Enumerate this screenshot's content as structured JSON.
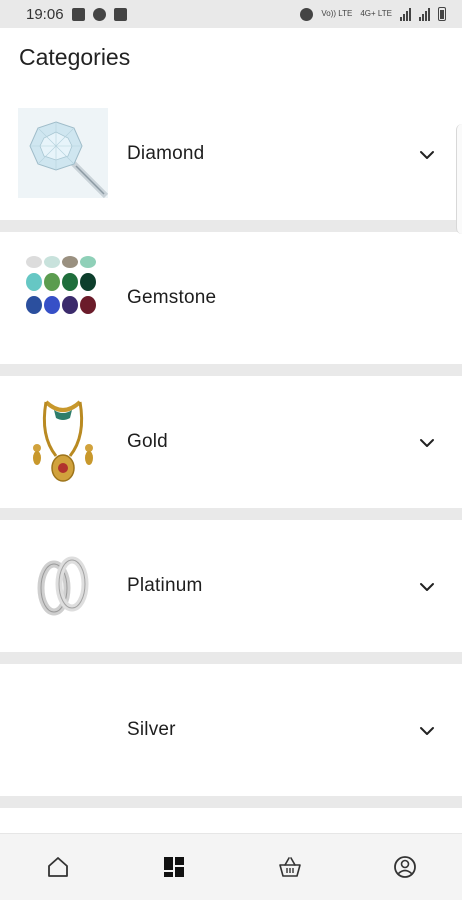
{
  "status_bar": {
    "time": "19:06",
    "volte_label": "Vo)) LTE",
    "fourg_label": "4G+ LTE"
  },
  "header": {
    "title": "Categories"
  },
  "categories": [
    {
      "label": "Diamond",
      "expandable": true,
      "image": "diamond-ring-image"
    },
    {
      "label": "Gemstone",
      "expandable": false,
      "image": "gemstones-grid-image"
    },
    {
      "label": "Gold",
      "expandable": true,
      "image": "gold-necklace-image"
    },
    {
      "label": "Platinum",
      "expandable": true,
      "image": "platinum-bands-image"
    },
    {
      "label": "Silver",
      "expandable": true,
      "image": ""
    }
  ],
  "bottom_nav": {
    "items": [
      {
        "icon": "home-icon",
        "active": false
      },
      {
        "icon": "categories-grid-icon",
        "active": true
      },
      {
        "icon": "basket-icon",
        "active": false
      },
      {
        "icon": "account-icon",
        "active": false
      }
    ]
  },
  "colors": {
    "divider": "#e9e9e9",
    "status_bar": "#e9e9e9",
    "nav_background": "#f4f4f4",
    "icon": "#333333",
    "text": "#1e1e1e"
  }
}
